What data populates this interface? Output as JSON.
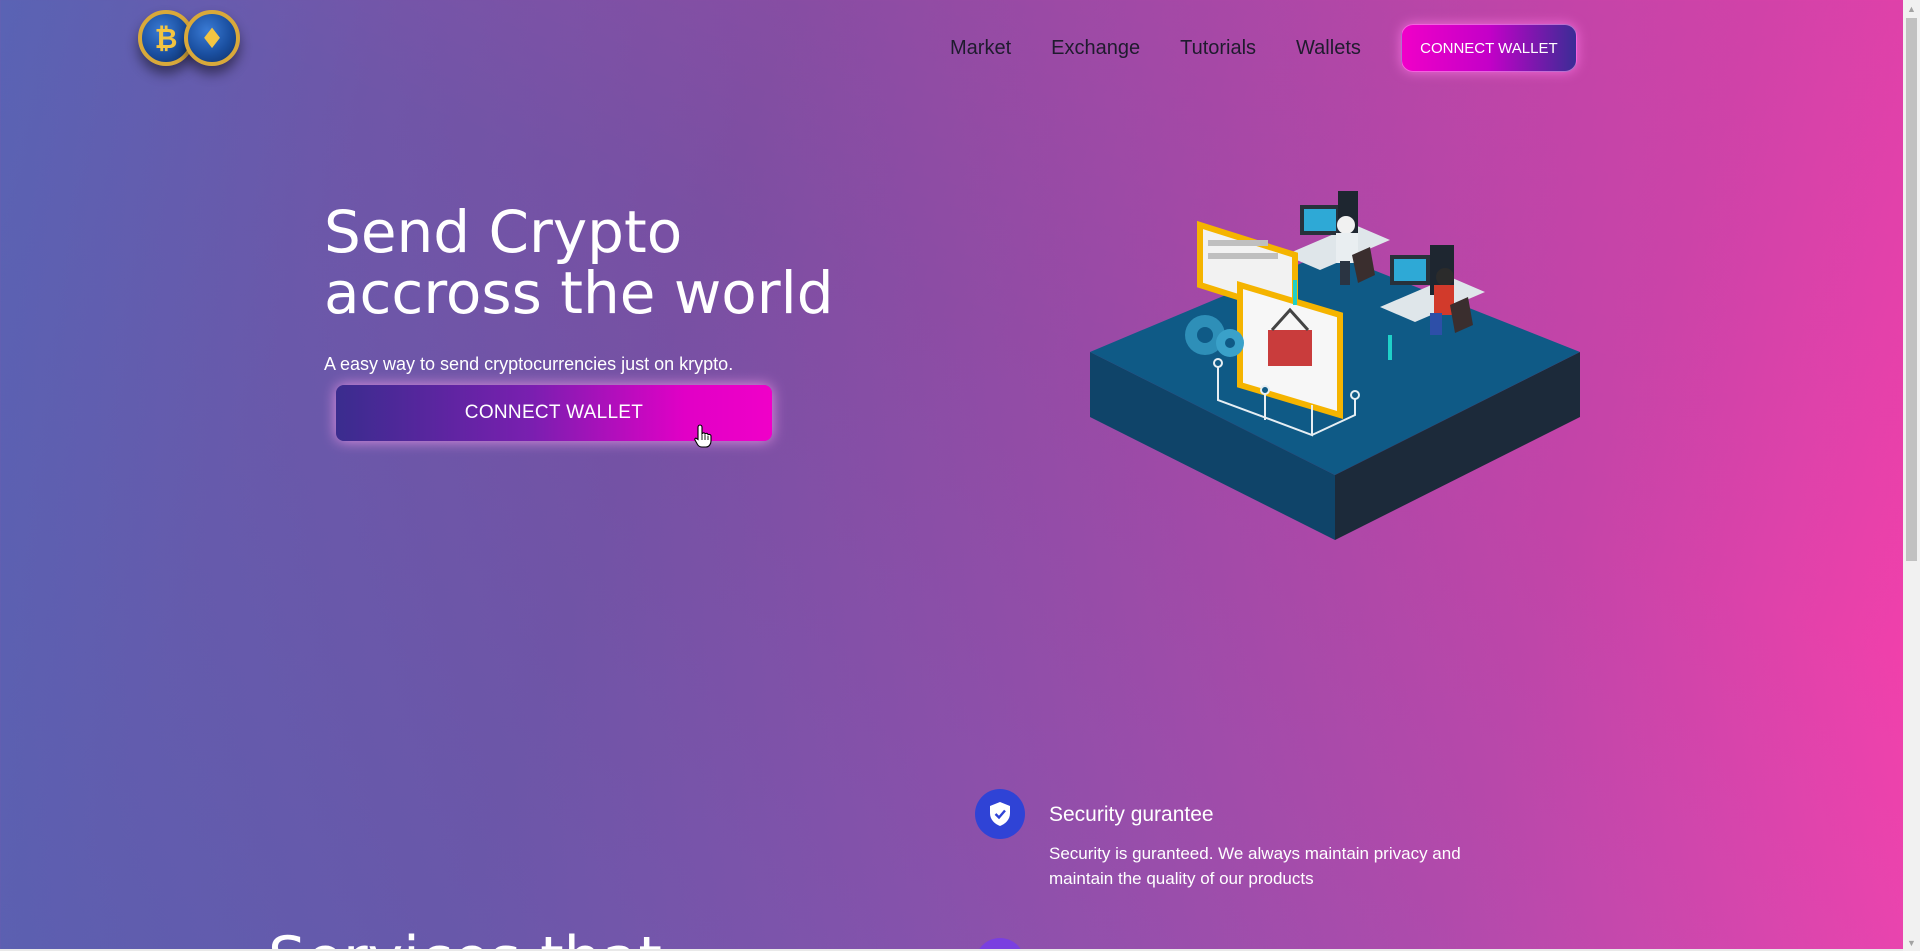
{
  "brand": {
    "logo_icons": [
      "bitcoin-coin-icon",
      "ethereum-coin-icon"
    ],
    "btc_glyph": "₿",
    "eth_glyph": "♦"
  },
  "nav": {
    "links": [
      "Market",
      "Exchange",
      "Tutorials",
      "Wallets"
    ],
    "cta_label": "CONNECT WALLET"
  },
  "hero": {
    "title_line1": "Send Crypto",
    "title_line2": "accross the world",
    "subtitle": "A easy way to send cryptocurrencies just on krypto.",
    "cta_label": "CONNECT WALLET",
    "illustration_icon": "isometric-trading-desk-illustration"
  },
  "features": [
    {
      "icon": "shield-check-icon",
      "title": "Security gurantee",
      "text": "Security is guranteed. We always maintain privacy and maintain the quality of our products"
    }
  ],
  "services_heading": "Services that",
  "colors": {
    "bg_left": "#5a63b4",
    "bg_right": "#ff3fac",
    "button_pink": "#f000c8",
    "button_indigo": "#3a2c8e",
    "feature_icon_blue": "#2f43d6",
    "feature_icon_purple": "#7a3fe0"
  }
}
